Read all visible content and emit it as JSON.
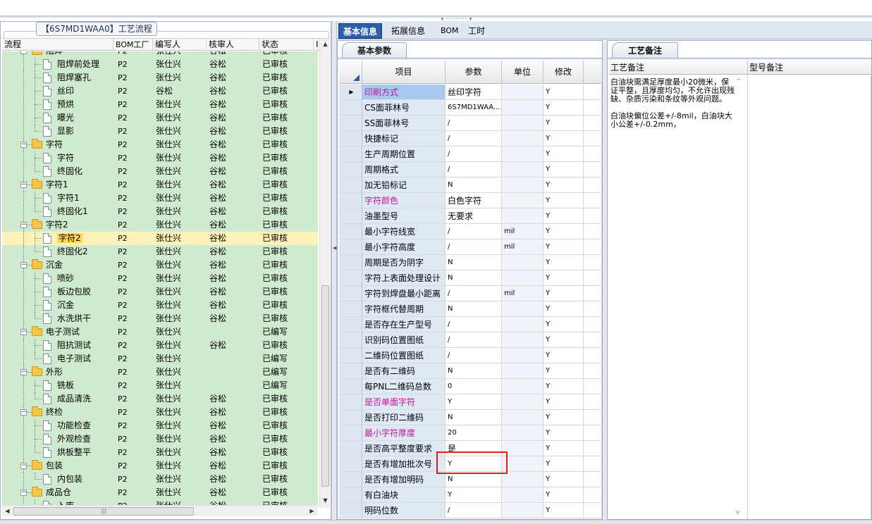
{
  "left_panel": {
    "group_title": "【6S7MD1WAA0】工艺流程",
    "columns": [
      "流程",
      "BOM工厂",
      "编写人",
      "核审人",
      "状态",
      "I"
    ],
    "rows": [
      {
        "name": "阻焊",
        "kind": "folder",
        "level": 0,
        "factory": "P2",
        "writer": "张仕兴",
        "reviewer": "谷松",
        "status": "已审核",
        "partial": true
      },
      {
        "name": "阻焊前处理",
        "kind": "doc",
        "level": 1,
        "factory": "P2",
        "writer": "张仕兴",
        "reviewer": "谷松",
        "status": "已审核"
      },
      {
        "name": "阻焊塞孔",
        "kind": "doc",
        "level": 1,
        "factory": "P2",
        "writer": "张仕兴",
        "reviewer": "谷松",
        "status": "已审核"
      },
      {
        "name": "丝印",
        "kind": "doc",
        "level": 1,
        "factory": "P2",
        "writer": "谷松",
        "reviewer": "谷松",
        "status": "已审核"
      },
      {
        "name": "预烘",
        "kind": "doc",
        "level": 1,
        "factory": "P2",
        "writer": "张仕兴",
        "reviewer": "谷松",
        "status": "已审核"
      },
      {
        "name": "曝光",
        "kind": "doc",
        "level": 1,
        "factory": "P2",
        "writer": "张仕兴",
        "reviewer": "谷松",
        "status": "已审核"
      },
      {
        "name": "显影",
        "kind": "doc",
        "level": 1,
        "factory": "P2",
        "writer": "张仕兴",
        "reviewer": "谷松",
        "status": "已审核",
        "last": true
      },
      {
        "name": "字符",
        "kind": "folder",
        "level": 0,
        "factory": "P2",
        "writer": "张仕兴",
        "reviewer": "谷松",
        "status": "已审核"
      },
      {
        "name": "字符",
        "kind": "doc",
        "level": 1,
        "factory": "P2",
        "writer": "张仕兴",
        "reviewer": "谷松",
        "status": "已审核"
      },
      {
        "name": "终固化",
        "kind": "doc",
        "level": 1,
        "factory": "P2",
        "writer": "张仕兴",
        "reviewer": "谷松",
        "status": "已审核",
        "last": true
      },
      {
        "name": "字符1",
        "kind": "folder",
        "level": 0,
        "factory": "P2",
        "writer": "张仕兴",
        "reviewer": "谷松",
        "status": "已审核"
      },
      {
        "name": "字符1",
        "kind": "doc",
        "level": 1,
        "factory": "P2",
        "writer": "张仕兴",
        "reviewer": "谷松",
        "status": "已审核"
      },
      {
        "name": "终固化1",
        "kind": "doc",
        "level": 1,
        "factory": "P2",
        "writer": "张仕兴",
        "reviewer": "谷松",
        "status": "已审核",
        "last": true
      },
      {
        "name": "字符2",
        "kind": "folder",
        "level": 0,
        "factory": "P2",
        "writer": "张仕兴",
        "reviewer": "谷松",
        "status": "已审核"
      },
      {
        "name": "字符2",
        "kind": "doc",
        "level": 1,
        "factory": "P2",
        "writer": "张仕兴",
        "reviewer": "谷松",
        "status": "已审核",
        "selected": true
      },
      {
        "name": "终固化2",
        "kind": "doc",
        "level": 1,
        "factory": "P2",
        "writer": "张仕兴",
        "reviewer": "谷松",
        "status": "已审核",
        "last": true
      },
      {
        "name": "沉金",
        "kind": "folder",
        "level": 0,
        "factory": "P2",
        "writer": "张仕兴",
        "reviewer": "谷松",
        "status": "已审核"
      },
      {
        "name": "喷砂",
        "kind": "doc",
        "level": 1,
        "factory": "P2",
        "writer": "张仕兴",
        "reviewer": "谷松",
        "status": "已审核"
      },
      {
        "name": "板边包胶",
        "kind": "doc",
        "level": 1,
        "factory": "P2",
        "writer": "张仕兴",
        "reviewer": "谷松",
        "status": "已审核"
      },
      {
        "name": "沉金",
        "kind": "doc",
        "level": 1,
        "factory": "P2",
        "writer": "张仕兴",
        "reviewer": "谷松",
        "status": "已审核"
      },
      {
        "name": "水洗烘干",
        "kind": "doc",
        "level": 1,
        "factory": "P2",
        "writer": "张仕兴",
        "reviewer": "谷松",
        "status": "已审核",
        "last": true
      },
      {
        "name": "电子测试",
        "kind": "folder",
        "level": 0,
        "factory": "P2",
        "writer": "张仕兴",
        "reviewer": "",
        "status": "已编写"
      },
      {
        "name": "阻抗测试",
        "kind": "doc",
        "level": 1,
        "factory": "P2",
        "writer": "张仕兴",
        "reviewer": "谷松",
        "status": "已审核"
      },
      {
        "name": "电子测试",
        "kind": "doc",
        "level": 1,
        "factory": "P2",
        "writer": "张仕兴",
        "reviewer": "",
        "status": "已编写",
        "last": true
      },
      {
        "name": "外形",
        "kind": "folder",
        "level": 0,
        "factory": "P2",
        "writer": "张仕兴",
        "reviewer": "",
        "status": "已编写"
      },
      {
        "name": "铣板",
        "kind": "doc",
        "level": 1,
        "factory": "P2",
        "writer": "张仕兴",
        "reviewer": "",
        "status": "已编写"
      },
      {
        "name": "成品清洗",
        "kind": "doc",
        "level": 1,
        "factory": "P2",
        "writer": "张仕兴",
        "reviewer": "谷松",
        "status": "已审核",
        "last": true
      },
      {
        "name": "终检",
        "kind": "folder",
        "level": 0,
        "factory": "P2",
        "writer": "张仕兴",
        "reviewer": "谷松",
        "status": "已审核"
      },
      {
        "name": "功能检查",
        "kind": "doc",
        "level": 1,
        "factory": "P2",
        "writer": "张仕兴",
        "reviewer": "谷松",
        "status": "已审核"
      },
      {
        "name": "外观检查",
        "kind": "doc",
        "level": 1,
        "factory": "P2",
        "writer": "张仕兴",
        "reviewer": "谷松",
        "status": "已审核"
      },
      {
        "name": "烘板整平",
        "kind": "doc",
        "level": 1,
        "factory": "P2",
        "writer": "张仕兴",
        "reviewer": "谷松",
        "status": "已审核",
        "last": true
      },
      {
        "name": "包装",
        "kind": "folder",
        "level": 0,
        "factory": "P2",
        "writer": "张仕兴",
        "reviewer": "谷松",
        "status": "已审核"
      },
      {
        "name": "内包装",
        "kind": "doc",
        "level": 1,
        "factory": "P2",
        "writer": "张仕兴",
        "reviewer": "谷松",
        "status": "已审核",
        "last": true
      },
      {
        "name": "成品仓",
        "kind": "folder",
        "level": 0,
        "factory": "P2",
        "writer": "张仕兴",
        "reviewer": "谷松",
        "status": "已审核"
      },
      {
        "name": "入库",
        "kind": "doc",
        "level": 1,
        "factory": "P2",
        "writer": "张仕兴",
        "reviewer": "谷松",
        "status": "已审核",
        "partial": true
      }
    ]
  },
  "tabs": [
    "基本信息",
    "拓展信息",
    "BOM",
    "工时"
  ],
  "params": {
    "tab_title": "基本参数",
    "columns": [
      "项目",
      "参数",
      "单位",
      "修改"
    ],
    "rows": [
      {
        "item": "印刷方式",
        "value": "丝印字符",
        "unit": "",
        "mod": "Y",
        "style": "hl",
        "current": true
      },
      {
        "item": "CS面菲林号",
        "value": "6S7MD1WAA...",
        "unit": "",
        "mod": "Y"
      },
      {
        "item": "SS面菲林号",
        "value": "/",
        "unit": "",
        "mod": "Y"
      },
      {
        "item": "快捷标记",
        "value": "/",
        "unit": "",
        "mod": "Y"
      },
      {
        "item": "生产周期位置",
        "value": "/",
        "unit": "",
        "mod": "Y"
      },
      {
        "item": "周期格式",
        "value": "/",
        "unit": "",
        "mod": "Y"
      },
      {
        "item": "加无铅标记",
        "value": "N",
        "unit": "",
        "mod": "Y"
      },
      {
        "item": "字符颜色",
        "value": "白色字符",
        "unit": "",
        "mod": "Y",
        "style": "magenta"
      },
      {
        "item": "油墨型号",
        "value": "无要求",
        "unit": "",
        "mod": "Y"
      },
      {
        "item": "最小字符线宽",
        "value": "/",
        "unit": "mil",
        "mod": "Y"
      },
      {
        "item": "最小字符高度",
        "value": "/",
        "unit": "mil",
        "mod": "Y"
      },
      {
        "item": "周期是否为阴字",
        "value": "N",
        "unit": "",
        "mod": "Y"
      },
      {
        "item": "字符上表面处理设计",
        "value": "N",
        "unit": "",
        "mod": "Y"
      },
      {
        "item": "字符到焊盘最小距离",
        "value": "/",
        "unit": "mil",
        "mod": "Y"
      },
      {
        "item": "字符框代替周期",
        "value": "N",
        "unit": "",
        "mod": "Y"
      },
      {
        "item": "是否存在生产型号",
        "value": "/",
        "unit": "",
        "mod": "Y"
      },
      {
        "item": "识别码位置图纸",
        "value": "/",
        "unit": "",
        "mod": "Y"
      },
      {
        "item": "二维码位置图纸",
        "value": "/",
        "unit": "",
        "mod": "Y"
      },
      {
        "item": "是否有二维码",
        "value": "N",
        "unit": "",
        "mod": "Y"
      },
      {
        "item": "每PNL二维码总数",
        "value": "0",
        "unit": "",
        "mod": "Y"
      },
      {
        "item": "是否单面字符",
        "value": "Y",
        "unit": "",
        "mod": "Y",
        "style": "magenta"
      },
      {
        "item": "是否打印二维码",
        "value": "N",
        "unit": "",
        "mod": "Y"
      },
      {
        "item": "最小字符厚度",
        "value": "20",
        "unit": "",
        "mod": "Y",
        "style": "magenta"
      },
      {
        "item": "是否高平整度要求",
        "value": "是",
        "unit": "",
        "mod": "Y"
      },
      {
        "item": "是否有增加批次号",
        "value": "Y",
        "unit": "",
        "mod": "Y"
      },
      {
        "item": "是否有增加明码",
        "value": "N",
        "unit": "",
        "mod": "Y"
      },
      {
        "item": "有白油块",
        "value": "Y",
        "unit": "",
        "mod": "Y"
      },
      {
        "item": "明码位数",
        "value": "/",
        "unit": "",
        "mod": "Y"
      }
    ]
  },
  "notes": {
    "tab_title": "工艺备注",
    "col_process": "工艺备注",
    "col_model": "型号备注",
    "text": "白油块需满足厚度最小20微米，保证平整，且厚度均匀，不允许出现残缺、杂质污染和条纹等外观问题。\n\n白油块偏位公差+/-8mil，白油块大小公差+/-0.2mm，"
  }
}
